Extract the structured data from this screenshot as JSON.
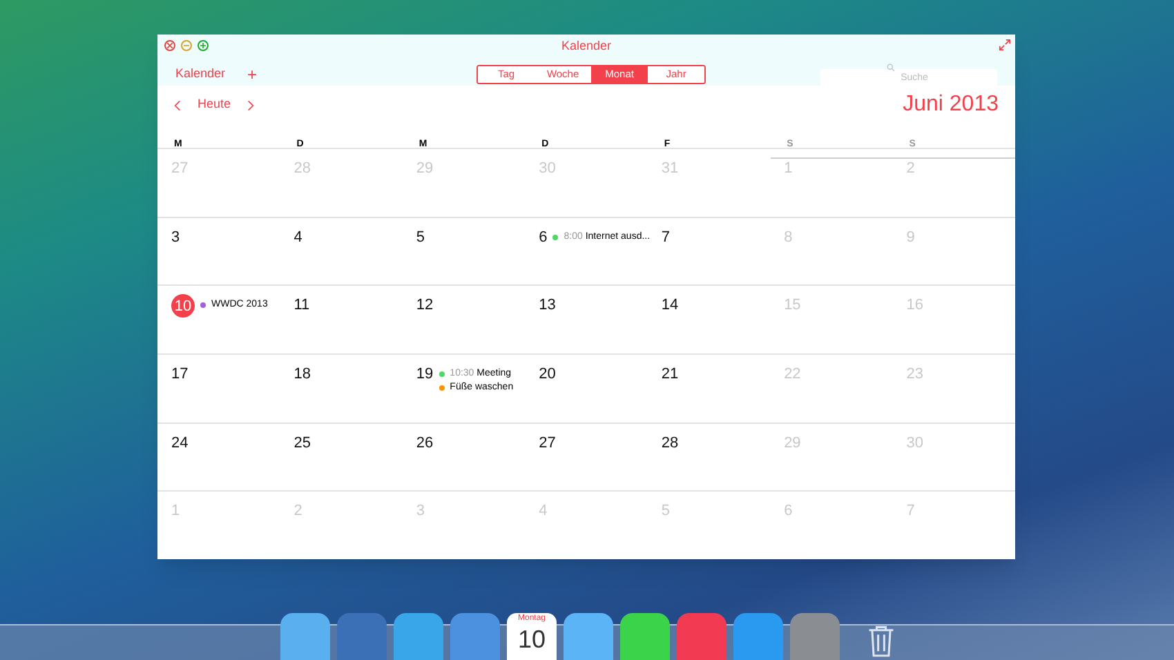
{
  "window": {
    "title": "Kalender"
  },
  "toolbar": {
    "calendars_button": "Kalender",
    "add_button": "+",
    "views": [
      {
        "label": "Tag",
        "selected": false
      },
      {
        "label": "Woche",
        "selected": false
      },
      {
        "label": "Monat",
        "selected": true
      },
      {
        "label": "Jahr",
        "selected": false
      }
    ],
    "search": {
      "placeholder": "Suche"
    }
  },
  "navigation": {
    "today_button": "Heute",
    "month_title": "Juni 2013"
  },
  "weekdays": [
    {
      "label": "M",
      "weekend": false
    },
    {
      "label": "D",
      "weekend": false
    },
    {
      "label": "M",
      "weekend": false
    },
    {
      "label": "D",
      "weekend": false
    },
    {
      "label": "F",
      "weekend": false
    },
    {
      "label": "S",
      "weekend": true
    },
    {
      "label": "S",
      "weekend": true
    }
  ],
  "weeks": [
    [
      {
        "day": "27",
        "dimmed": true,
        "today": false
      },
      {
        "day": "28",
        "dimmed": true,
        "today": false
      },
      {
        "day": "29",
        "dimmed": true,
        "today": false
      },
      {
        "day": "30",
        "dimmed": true,
        "today": false
      },
      {
        "day": "31",
        "dimmed": true,
        "today": false
      },
      {
        "day": "1",
        "dimmed": true,
        "today": false
      },
      {
        "day": "2",
        "dimmed": true,
        "today": false
      }
    ],
    [
      {
        "day": "3",
        "dimmed": false,
        "today": false
      },
      {
        "day": "4",
        "dimmed": false,
        "today": false
      },
      {
        "day": "5",
        "dimmed": false,
        "today": false
      },
      {
        "day": "6",
        "dimmed": false,
        "today": false,
        "events": [
          {
            "time": "8:00",
            "title": "Internet ausd...",
            "color": "#4cd964"
          }
        ]
      },
      {
        "day": "7",
        "dimmed": false,
        "today": false
      },
      {
        "day": "8",
        "dimmed": true,
        "today": false
      },
      {
        "day": "9",
        "dimmed": true,
        "today": false
      }
    ],
    [
      {
        "day": "10",
        "dimmed": false,
        "today": true,
        "events": [
          {
            "title": "WWDC 2013",
            "color": "#a45fd6"
          }
        ]
      },
      {
        "day": "11",
        "dimmed": false,
        "today": false
      },
      {
        "day": "12",
        "dimmed": false,
        "today": false
      },
      {
        "day": "13",
        "dimmed": false,
        "today": false
      },
      {
        "day": "14",
        "dimmed": false,
        "today": false
      },
      {
        "day": "15",
        "dimmed": true,
        "today": false
      },
      {
        "day": "16",
        "dimmed": true,
        "today": false
      }
    ],
    [
      {
        "day": "17",
        "dimmed": false,
        "today": false
      },
      {
        "day": "18",
        "dimmed": false,
        "today": false
      },
      {
        "day": "19",
        "dimmed": false,
        "today": false,
        "events": [
          {
            "time": "10:30",
            "title": "Meeting",
            "color": "#4cd964"
          },
          {
            "title": "Füße waschen",
            "color": "#ff9500"
          }
        ]
      },
      {
        "day": "20",
        "dimmed": false,
        "today": false
      },
      {
        "day": "21",
        "dimmed": false,
        "today": false
      },
      {
        "day": "22",
        "dimmed": true,
        "today": false
      },
      {
        "day": "23",
        "dimmed": true,
        "today": false
      }
    ],
    [
      {
        "day": "24",
        "dimmed": false,
        "today": false
      },
      {
        "day": "25",
        "dimmed": false,
        "today": false
      },
      {
        "day": "26",
        "dimmed": false,
        "today": false
      },
      {
        "day": "27",
        "dimmed": false,
        "today": false
      },
      {
        "day": "28",
        "dimmed": false,
        "today": false
      },
      {
        "day": "29",
        "dimmed": true,
        "today": false
      },
      {
        "day": "30",
        "dimmed": true,
        "today": false
      }
    ],
    [
      {
        "day": "1",
        "dimmed": true,
        "today": false
      },
      {
        "day": "2",
        "dimmed": true,
        "today": false
      },
      {
        "day": "3",
        "dimmed": true,
        "today": false
      },
      {
        "day": "4",
        "dimmed": true,
        "today": false
      },
      {
        "day": "5",
        "dimmed": true,
        "today": false
      },
      {
        "day": "6",
        "dimmed": true,
        "today": false
      },
      {
        "day": "7",
        "dimmed": true,
        "today": false
      }
    ]
  ],
  "dock": {
    "calendar_icon": {
      "weekday": "Montag",
      "day": "10"
    }
  }
}
